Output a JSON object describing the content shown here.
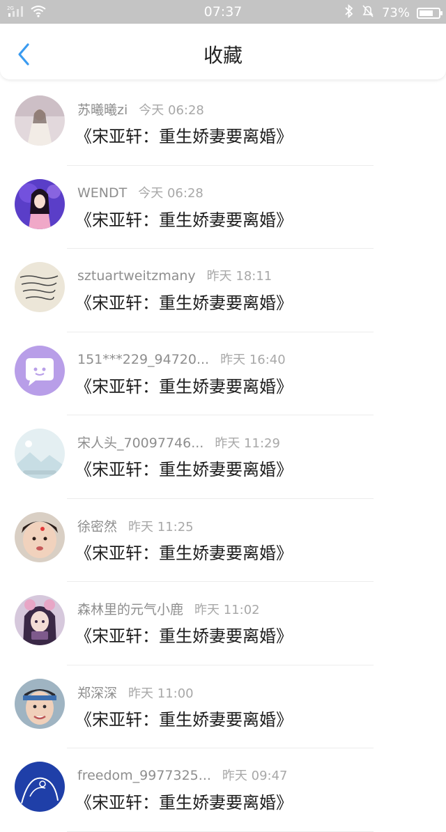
{
  "status_bar": {
    "network": "2G",
    "time": "07:37",
    "battery": "73%",
    "battery_level": 0.73
  },
  "header": {
    "title": "收藏",
    "back_icon": "chevron-left-icon",
    "accent_color": "#3a9bf0"
  },
  "favorites": [
    {
      "name": "苏曦曦zi",
      "time": "今天 06:28",
      "text": "《宋亚轩：重生娇妻要离婚》"
    },
    {
      "name": "WENDT",
      "time": "今天 06:28",
      "text": "《宋亚轩：重生娇妻要离婚》"
    },
    {
      "name": "sztuartweitzmany",
      "time": "昨天 18:11",
      "text": "《宋亚轩：重生娇妻要离婚》"
    },
    {
      "name": "151***229_94720...",
      "time": "昨天 16:40",
      "text": "《宋亚轩：重生娇妻要离婚》"
    },
    {
      "name": "宋人头_70097746...",
      "time": "昨天 11:29",
      "text": "《宋亚轩：重生娇妻要离婚》"
    },
    {
      "name": "徐密然",
      "time": "昨天 11:25",
      "text": "《宋亚轩：重生娇妻要离婚》"
    },
    {
      "name": "森林里的元气小鹿",
      "time": "昨天 11:02",
      "text": "《宋亚轩：重生娇妻要离婚》"
    },
    {
      "name": "郑深深",
      "time": "昨天 11:00",
      "text": "《宋亚轩：重生娇妻要离婚》"
    },
    {
      "name": "freedom_9977325...",
      "time": "昨天 09:47",
      "text": "《宋亚轩：重生娇妻要离婚》"
    }
  ]
}
